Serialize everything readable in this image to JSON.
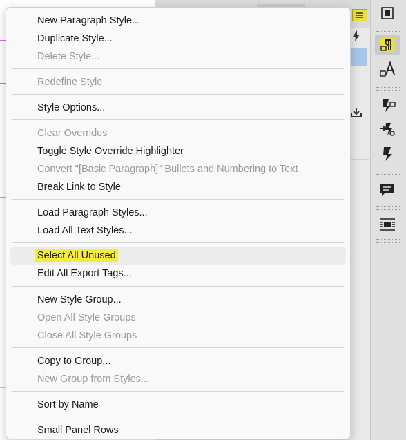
{
  "menu": {
    "items": [
      {
        "label": "New Paragraph Style...",
        "enabled": true
      },
      {
        "label": "Duplicate Style...",
        "enabled": true
      },
      {
        "label": "Delete Style...",
        "enabled": false
      },
      {
        "label": "Redefine Style",
        "enabled": false
      },
      {
        "label": "Style Options...",
        "enabled": true
      },
      {
        "label": "Clear Overrides",
        "enabled": false
      },
      {
        "label": "Toggle Style Override Highlighter",
        "enabled": true
      },
      {
        "label": "Convert \"[Basic Paragraph]\" Bullets and Numbering to Text",
        "enabled": false
      },
      {
        "label": "Break Link to Style",
        "enabled": true
      },
      {
        "label": "Load Paragraph Styles...",
        "enabled": true
      },
      {
        "label": "Load All Text Styles...",
        "enabled": true
      },
      {
        "label": "Select All Unused",
        "enabled": true,
        "highlighted": true
      },
      {
        "label": "Edit All Export Tags...",
        "enabled": true
      },
      {
        "label": "New Style Group...",
        "enabled": true
      },
      {
        "label": "Open All Style Groups",
        "enabled": false
      },
      {
        "label": "Close All Style Groups",
        "enabled": false
      },
      {
        "label": "Copy to Group...",
        "enabled": true
      },
      {
        "label": "New Group from Styles...",
        "enabled": false
      },
      {
        "label": "Sort by Name",
        "enabled": true
      },
      {
        "label": "Small Panel Rows",
        "enabled": true
      }
    ]
  },
  "toolbar": {
    "buttons": [
      {
        "icon": "frame-transform-icon",
        "active": false
      },
      {
        "icon": "paragraph-styles-icon",
        "active": true,
        "color": "#e8e23a"
      },
      {
        "icon": "character-styles-icon",
        "active": false
      },
      {
        "icon": "object-styles-icon",
        "active": false
      },
      {
        "icon": "table-styles-icon",
        "active": false
      },
      {
        "icon": "cell-styles-icon",
        "active": false
      },
      {
        "icon": "comments-icon",
        "active": false
      },
      {
        "icon": "text-wrap-icon",
        "active": false
      }
    ]
  },
  "colors": {
    "highlight": "#f2ee3a",
    "menu_background": "#f9f9f9",
    "disabled_text": "#9a9a9a"
  }
}
